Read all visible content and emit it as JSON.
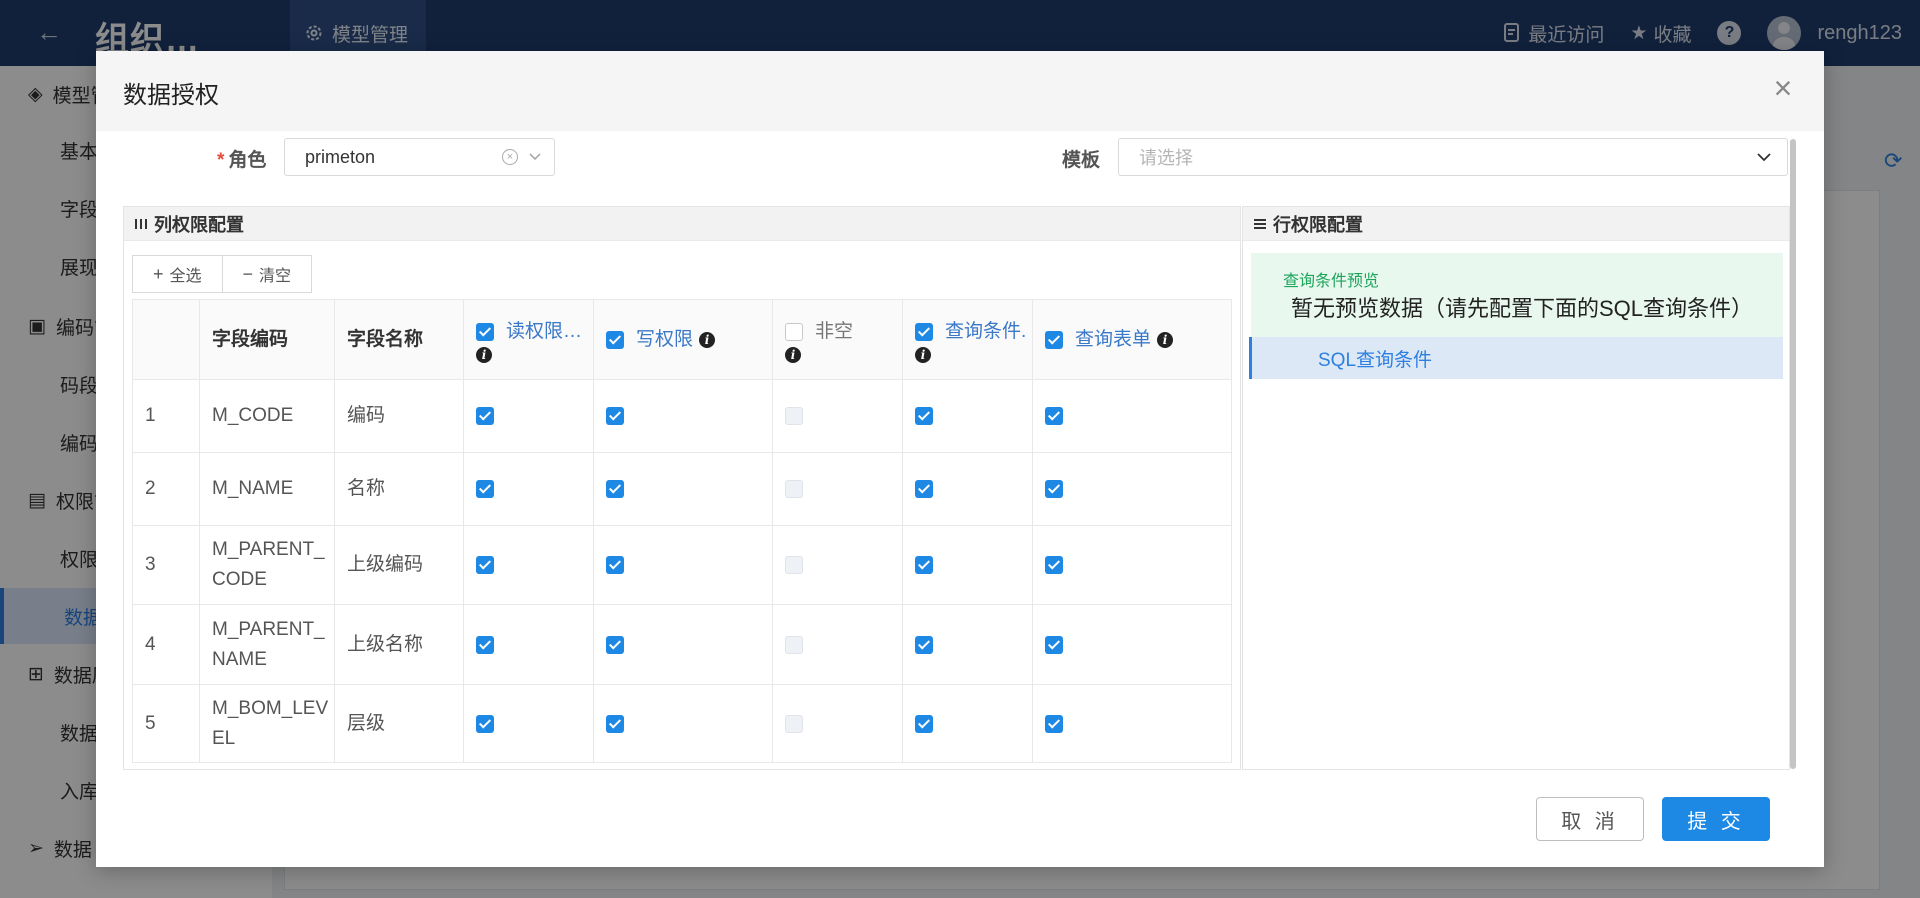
{
  "app": {
    "title": "组织…",
    "top_tab": "模型管理",
    "recent": "最近访问",
    "favorites": "收藏",
    "help": "?",
    "username": "rengh123"
  },
  "sidebar": {
    "items": [
      {
        "label": "模型管",
        "kind": "group"
      },
      {
        "label": "基本",
        "kind": "sub"
      },
      {
        "label": "字段",
        "kind": "sub"
      },
      {
        "label": "展现",
        "kind": "sub"
      },
      {
        "label": "编码管",
        "kind": "group"
      },
      {
        "label": "码段",
        "kind": "sub"
      },
      {
        "label": "编码",
        "kind": "sub"
      },
      {
        "label": "权限管",
        "kind": "group"
      },
      {
        "label": "权限",
        "kind": "sub"
      },
      {
        "label": "数据",
        "kind": "sub",
        "active": true
      },
      {
        "label": "数据原",
        "kind": "group"
      },
      {
        "label": "数据",
        "kind": "sub"
      },
      {
        "label": "入库",
        "kind": "sub"
      },
      {
        "label": "数据",
        "kind": "group"
      }
    ]
  },
  "dialog": {
    "title": "数据授权",
    "role_label": "角色",
    "role_value": "primeton",
    "template_label": "模板",
    "template_placeholder": "请选择",
    "column_panel_title": "列权限配置",
    "row_panel_title": "行权限配置",
    "select_all": "全选",
    "clear": "清空",
    "preview_label": "查询条件预览",
    "preview_text": "暂无预览数据（请先配置下面的SQL查询条件）",
    "sql_condition": "SQL查询条件",
    "cancel": "取 消",
    "submit": "提 交"
  },
  "table": {
    "headers": {
      "index": "",
      "code": "字段编码",
      "name": "字段名称",
      "read": "读权限…",
      "write": "写权限",
      "notnull": "非空",
      "query": "查询条件.",
      "form": "查询表单"
    },
    "header_checks": {
      "read": true,
      "write": true,
      "notnull": false,
      "query": true,
      "form": true
    },
    "rows": [
      {
        "index": "1",
        "code": "M_CODE",
        "name": "编码",
        "read": true,
        "write": true,
        "notnull": false,
        "query": true,
        "form": true
      },
      {
        "index": "2",
        "code": "M_NAME",
        "name": "名称",
        "read": true,
        "write": true,
        "notnull": false,
        "query": true,
        "form": true
      },
      {
        "index": "3",
        "code": "M_PARENT_CODE",
        "name": "上级编码",
        "read": true,
        "write": true,
        "notnull": false,
        "query": true,
        "form": true
      },
      {
        "index": "4",
        "code": "M_PARENT_NAME",
        "name": "上级名称",
        "read": true,
        "write": true,
        "notnull": false,
        "query": true,
        "form": true
      },
      {
        "index": "5",
        "code": "M_BOM_LEVEL",
        "name": "层级",
        "read": true,
        "write": true,
        "notnull": false,
        "query": true,
        "form": true
      }
    ]
  },
  "colors": {
    "header_bg": "#1f3d6e",
    "accent": "#1e88e5",
    "preview_bg": "#e9f8ef",
    "preview_label": "#1aa55a"
  },
  "icons": [
    "back-arrow-icon",
    "gear-icon",
    "recent-icon",
    "star-icon",
    "help-icon",
    "avatar-icon",
    "close-icon",
    "clear-circle-icon",
    "chevron-down-icon",
    "columns-icon",
    "list-icon",
    "plus-icon",
    "minus-icon",
    "info-icon",
    "refresh-icon"
  ]
}
